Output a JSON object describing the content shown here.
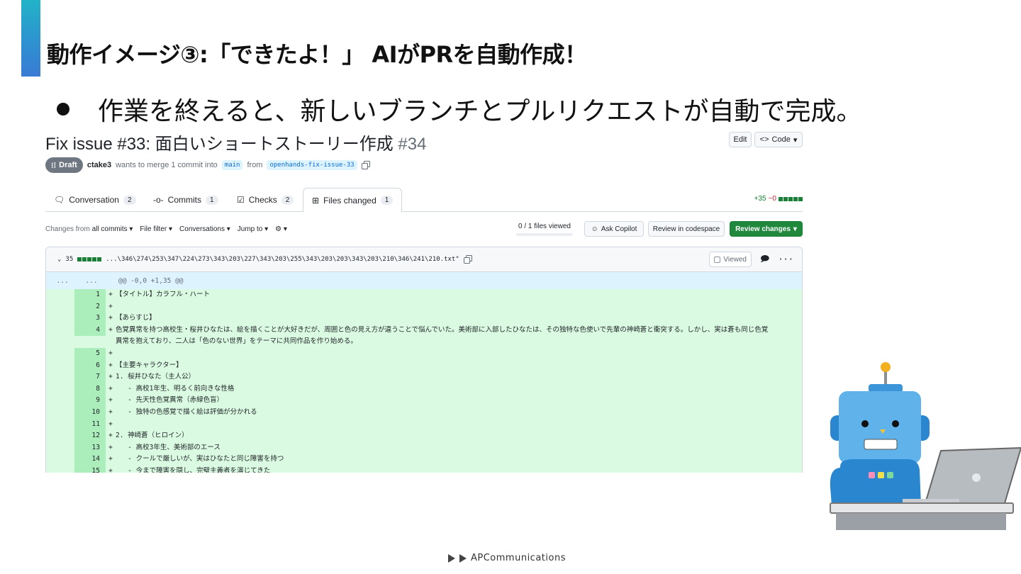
{
  "slide": {
    "title": "動作イメージ③:「できたよ！」 AIがPRを自動作成！",
    "bullet": "作業を終えると、新しいブランチとプルリクエストが自動で完成。",
    "footer": "APCommunications"
  },
  "pr": {
    "title": "Fix issue #33: 面白いショートストーリー作成",
    "number": "#34",
    "edit_label": "Edit",
    "code_label": "Code",
    "draft_label": "Draft",
    "author": "ctake3",
    "meta_mid": "wants to merge 1 commit into",
    "base_branch": "main",
    "meta_from": "from",
    "head_branch": "openhands-fix-issue-33"
  },
  "tabs": [
    {
      "label": "Conversation",
      "count": "2"
    },
    {
      "label": "Commits",
      "count": "1"
    },
    {
      "label": "Checks",
      "count": "2"
    },
    {
      "label": "Files changed",
      "count": "1"
    }
  ],
  "diffstat": {
    "additions": "+35",
    "deletions": "−0"
  },
  "toolbar": {
    "changes_from_prefix": "Changes from",
    "changes_from_value": "all commits",
    "file_filter": "File filter",
    "conversations": "Conversations",
    "jump_to": "Jump to",
    "files_viewed": "0 / 1 files viewed",
    "ask_copilot": "Ask Copilot",
    "review_codespace": "Review in codespace",
    "review_changes": "Review changes"
  },
  "file": {
    "count": "35",
    "path": "...\\346\\274\\253\\347\\224\\273\\343\\203\\227\\343\\203\\255\\343\\203\\203\\343\\203\\210\\346\\241\\210.txt\"",
    "viewed_label": "Viewed",
    "hunk_left": "...",
    "hunk_right": "...",
    "hunk_header": "@@ -0,0 +1,35 @@",
    "lines": [
      {
        "n": "1",
        "text": "【タイトル】カラフル・ハート"
      },
      {
        "n": "2",
        "text": ""
      },
      {
        "n": "3",
        "text": "【あらすじ】"
      },
      {
        "n": "4",
        "text": "色覚異常を持つ高校生・桜井ひなたは、絵を描くことが大好きだが、周囲と色の見え方が違うことで悩んでいた。美術部に入部したひなたは、その独特な色使いで先輩の神崎蒼と衝突する。しかし、実は蒼も同じ色覚異常を抱えており、二人は「色のない世界」をテーマに共同作品を作り始める。"
      },
      {
        "n": "5",
        "text": ""
      },
      {
        "n": "6",
        "text": "【主要キャラクター】"
      },
      {
        "n": "7",
        "text": "1. 桜井ひなた（主人公）"
      },
      {
        "n": "8",
        "text": "   - 高校1年生、明るく前向きな性格"
      },
      {
        "n": "9",
        "text": "   - 先天性色覚異常（赤緑色盲）"
      },
      {
        "n": "10",
        "text": "   - 独特の色感覚で描く絵は評価が分かれる"
      },
      {
        "n": "11",
        "text": ""
      },
      {
        "n": "12",
        "text": "2. 神崎蒼（ヒロイン）"
      },
      {
        "n": "13",
        "text": "   - 高校3年生、美術部のエース"
      },
      {
        "n": "14",
        "text": "   - クールで厳しいが、実はひなたと同じ障害を持つ"
      },
      {
        "n": "15",
        "text": "   - 今まで障害を隠し、完璧主義者を演じてきた"
      }
    ]
  }
}
